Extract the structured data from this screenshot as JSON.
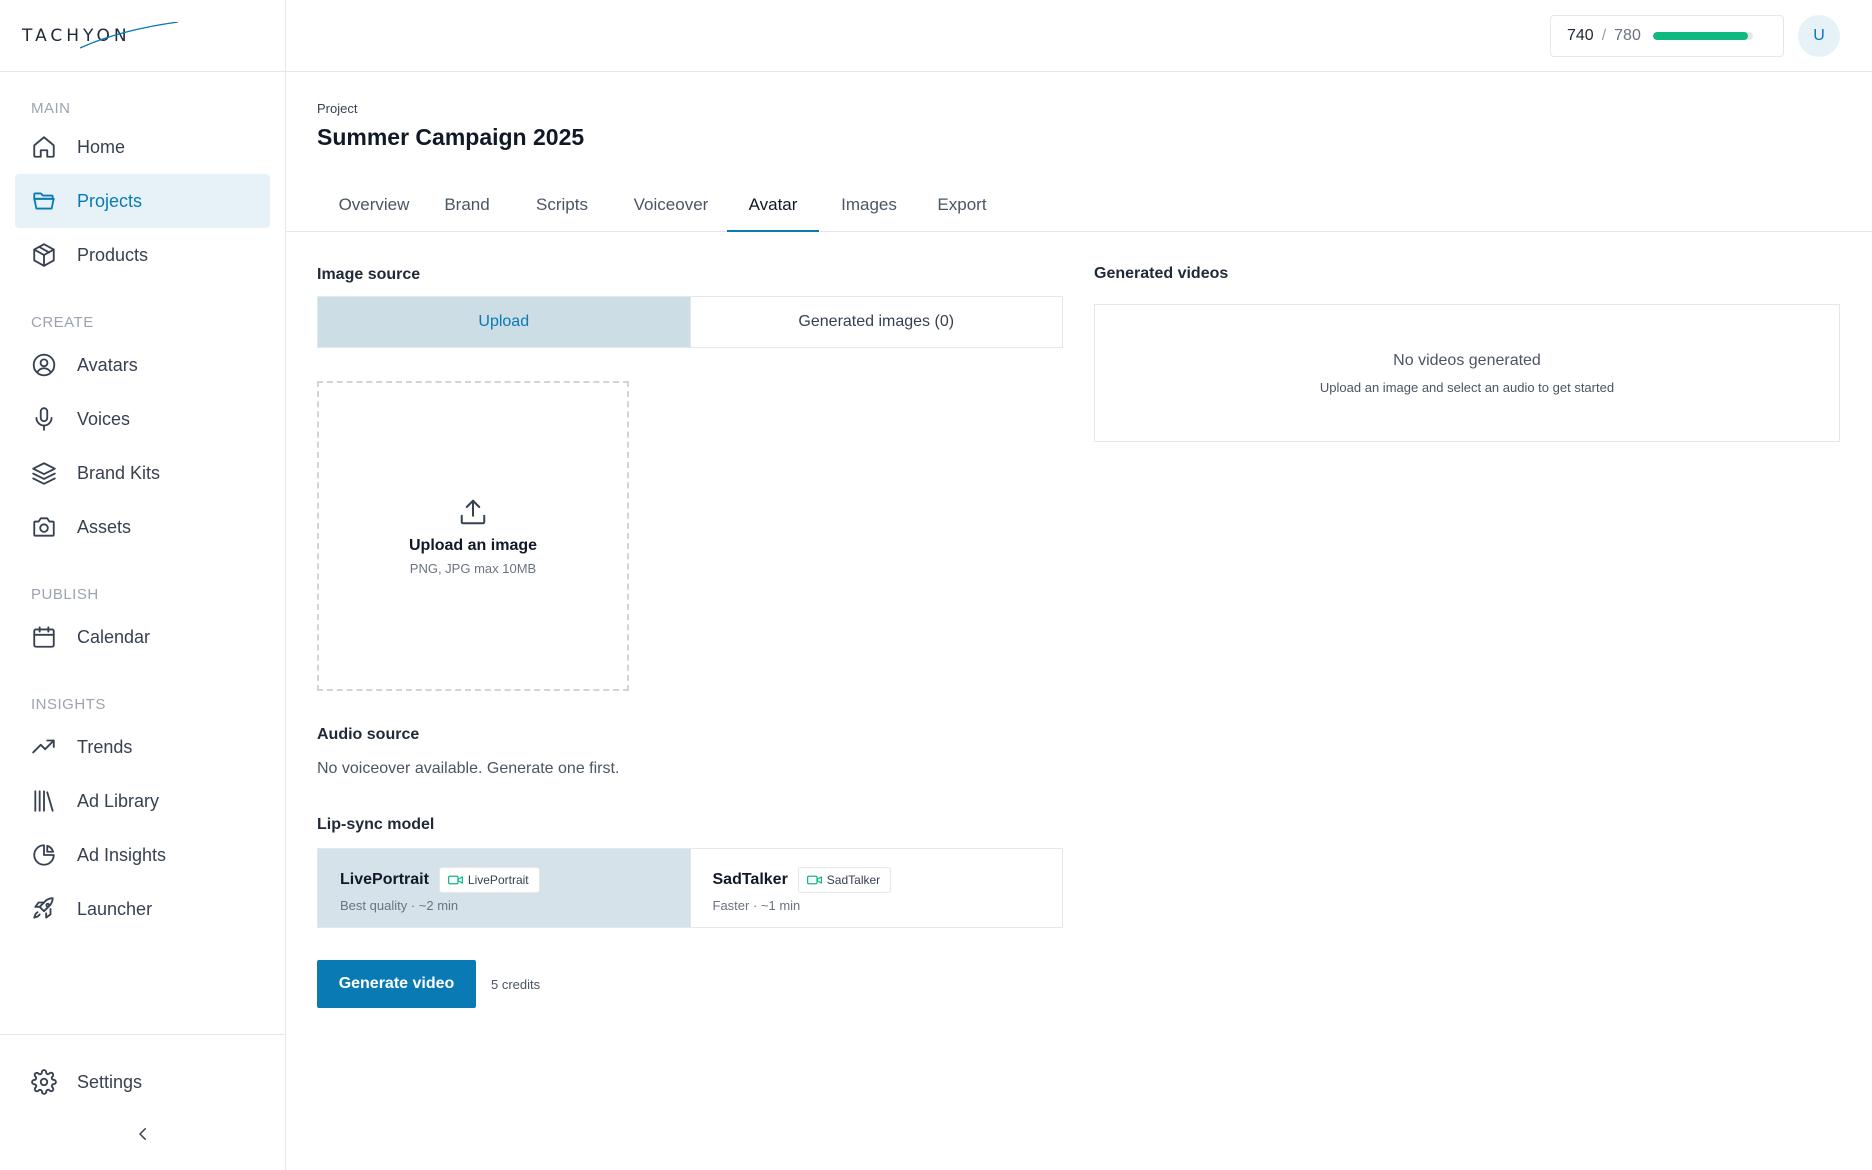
{
  "brand": {
    "name": "TACHYON",
    "icon": "tachyon-logo"
  },
  "sidebar": {
    "sections": [
      {
        "label": "MAIN",
        "items": [
          {
            "label": "Home",
            "icon": "home-icon"
          },
          {
            "label": "Projects",
            "icon": "folder-icon",
            "active": true
          },
          {
            "label": "Products",
            "icon": "box-icon"
          }
        ]
      },
      {
        "label": "CREATE",
        "items": [
          {
            "label": "Avatars",
            "icon": "user-circle-icon"
          },
          {
            "label": "Voices",
            "icon": "microphone-icon"
          },
          {
            "label": "Brand Kits",
            "icon": "layers-icon"
          },
          {
            "label": "Assets",
            "icon": "camera-icon"
          }
        ]
      },
      {
        "label": "PUBLISH",
        "items": [
          {
            "label": "Calendar",
            "icon": "calendar-icon"
          }
        ]
      },
      {
        "label": "INSIGHTS",
        "items": [
          {
            "label": "Trends",
            "icon": "trending-up-icon"
          },
          {
            "label": "Ad Library",
            "icon": "library-icon"
          },
          {
            "label": "Ad Insights",
            "icon": "pie-chart-icon"
          },
          {
            "label": "Launcher",
            "icon": "rocket-icon"
          }
        ]
      }
    ],
    "settings_label": "Settings"
  },
  "topbar": {
    "credits_used": "740",
    "credits_separator": "/",
    "credits_total": "780",
    "credits_fraction": 0.949,
    "user_initial": "U"
  },
  "project": {
    "label": "Project",
    "title": "Summer Campaign 2025"
  },
  "tabs": [
    {
      "label": "Overview"
    },
    {
      "label": "Brand"
    },
    {
      "label": "Scripts"
    },
    {
      "label": "Voiceover"
    },
    {
      "label": "Avatar",
      "active": true
    },
    {
      "label": "Images"
    },
    {
      "label": "Export"
    }
  ],
  "image_source": {
    "label": "Image source",
    "options": [
      {
        "label": "Upload",
        "active": true
      },
      {
        "label": "Generated images (0)"
      }
    ]
  },
  "upload": {
    "title": "Upload an image",
    "hint": "PNG, JPG max 10MB"
  },
  "audio_source": {
    "label": "Audio source",
    "empty_text": "No voiceover available. Generate one first."
  },
  "lipsync": {
    "label": "Lip-sync model",
    "models": [
      {
        "name": "LivePortrait",
        "badge": "LivePortrait",
        "desc": "Best quality · ~2 min",
        "active": true
      },
      {
        "name": "SadTalker",
        "badge": "SadTalker",
        "desc": "Faster · ~1 min"
      }
    ]
  },
  "generate": {
    "button_label": "Generate video",
    "cost": "5 credits"
  },
  "videos": {
    "label": "Generated videos",
    "empty_title": "No videos generated",
    "empty_hint": "Upload an image and select an audio to get started"
  },
  "colors": {
    "accent": "#0a7ab5",
    "progress": "#10b981"
  }
}
